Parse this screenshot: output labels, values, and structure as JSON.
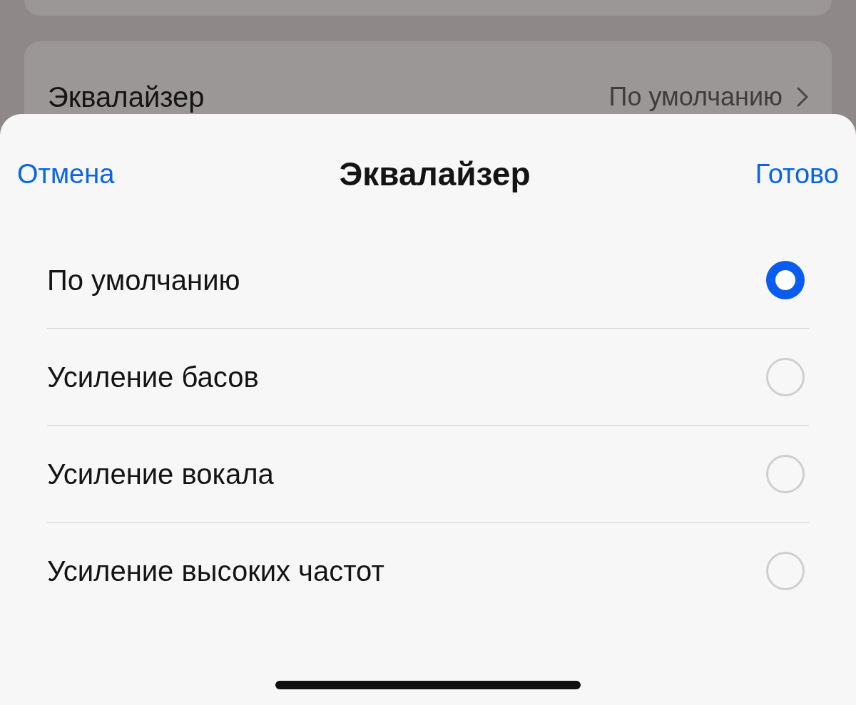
{
  "background": {
    "setting": {
      "label": "Эквалайзер",
      "value": "По умолчанию"
    }
  },
  "sheet": {
    "cancel": "Отмена",
    "title": "Эквалайзер",
    "done": "Готово",
    "options": [
      {
        "label": "По умолчанию",
        "selected": true
      },
      {
        "label": "Усиление басов",
        "selected": false
      },
      {
        "label": "Усиление вокала",
        "selected": false
      },
      {
        "label": "Усиление высоких частот",
        "selected": false
      }
    ]
  }
}
